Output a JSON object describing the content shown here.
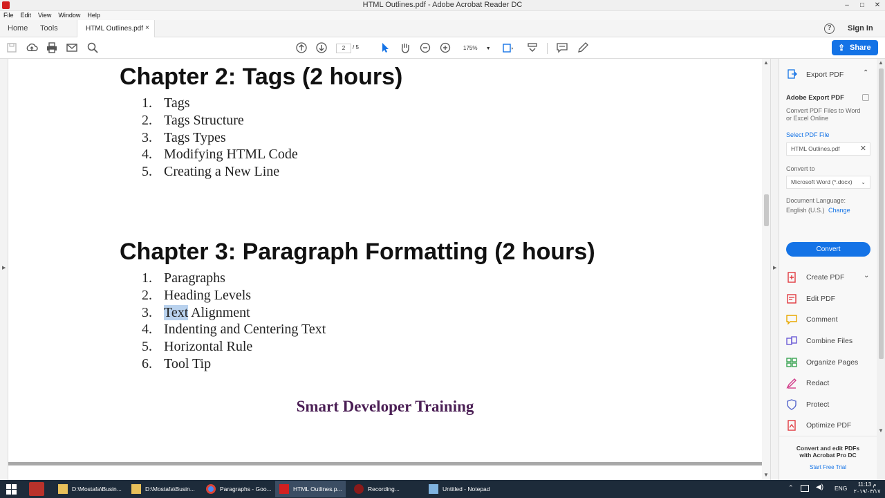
{
  "window": {
    "title": "HTML Outlines.pdf - Adobe Acrobat Reader DC",
    "controls": [
      "–",
      "□",
      "✕"
    ]
  },
  "menu": [
    "File",
    "Edit",
    "View",
    "Window",
    "Help"
  ],
  "tabs": {
    "home": "Home",
    "tools": "Tools",
    "document": "HTML Outlines.pdf",
    "close": "×",
    "sign_in": "Sign In",
    "help": "?"
  },
  "toolbar": {
    "page_current": "2",
    "page_total": "/ 5",
    "zoom": "175%",
    "share": "Share"
  },
  "document": {
    "chapters": [
      {
        "title": "Chapter 2: Tags (2 hours)",
        "items": [
          "Tags",
          "Tags Structure",
          "Tags Types",
          "Modifying HTML Code",
          "Creating a New Line"
        ]
      },
      {
        "title": "Chapter 3: Paragraph Formatting (2 hours)",
        "items": [
          "Paragraphs",
          "Heading Levels",
          "Text Alignment",
          "Indenting and Centering Text",
          "Horizontal Rule",
          "Tool Tip"
        ]
      }
    ],
    "selected_word": "Text",
    "selected_rest": " Alignment",
    "footer": "Smart Developer Training"
  },
  "right_panel": {
    "export_header": "Export PDF",
    "adobe_export_title": "Adobe Export PDF",
    "adobe_export_desc1": "Convert PDF Files to Word",
    "adobe_export_desc2": "or Excel Online",
    "select_file_link": "Select PDF File",
    "selected_file": "HTML Outlines.pdf",
    "convert_to_label": "Convert to",
    "convert_to_value": "Microsoft Word (*.docx)",
    "doc_lang_label": "Document Language:",
    "doc_lang_value": "English (U.S.)",
    "doc_lang_change": "Change",
    "convert_button": "Convert",
    "tools": [
      {
        "label": "Create PDF",
        "color": "#e0383e"
      },
      {
        "label": "Edit PDF",
        "color": "#e0383e"
      },
      {
        "label": "Comment",
        "color": "#e8a800"
      },
      {
        "label": "Combine Files",
        "color": "#6b5bd6"
      },
      {
        "label": "Organize Pages",
        "color": "#3aa453"
      },
      {
        "label": "Redact",
        "color": "#d23e8a"
      },
      {
        "label": "Protect",
        "color": "#5566cc"
      },
      {
        "label": "Optimize PDF",
        "color": "#e0383e"
      }
    ],
    "promo_line1": "Convert and edit PDFs",
    "promo_line2": "with Acrobat Pro DC",
    "promo_link": "Start Free Trial"
  },
  "taskbar": {
    "tasks": [
      "D:\\Mostafa\\Busin...",
      "D:\\Mostafa\\Busin...",
      "Paragraphs - Goo...",
      "HTML Outlines.p...",
      "Recording...",
      "Untitled - Notepad"
    ],
    "lang": "ENG",
    "time": "11:13 م",
    "date": "٢٠١٩/٠٣/١٧"
  }
}
